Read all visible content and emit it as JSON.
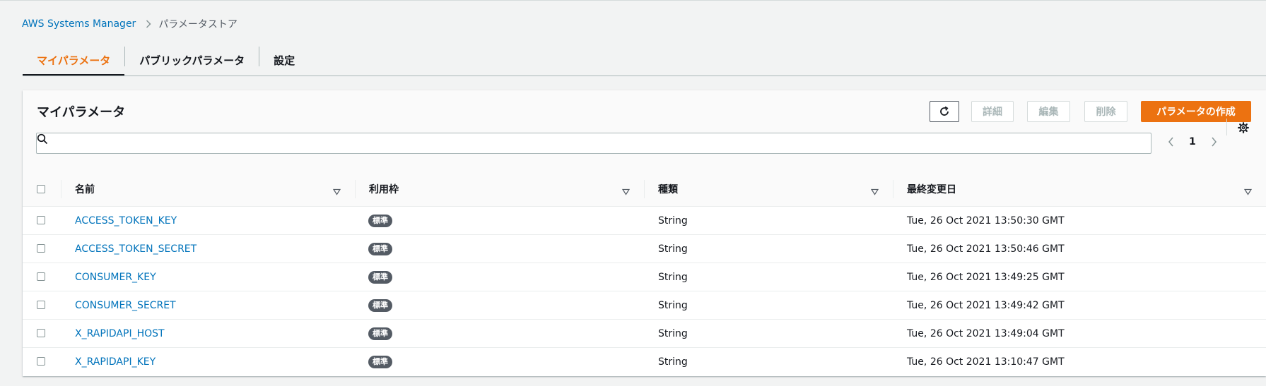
{
  "breadcrumb": {
    "root": "AWS Systems Manager",
    "current": "パラメータストア"
  },
  "tabs": [
    {
      "label": "マイパラメータ",
      "active": true
    },
    {
      "label": "パブリックパラメータ",
      "active": false
    },
    {
      "label": "設定",
      "active": false
    }
  ],
  "panel": {
    "title": "マイパラメータ",
    "buttons": {
      "details": "詳細",
      "edit": "編集",
      "delete": "削除",
      "create": "パラメータの作成"
    },
    "search": {
      "value": "",
      "placeholder": ""
    },
    "pagination": {
      "current_page": "1"
    },
    "table": {
      "columns": [
        "名前",
        "利用枠",
        "種類",
        "最終変更日"
      ],
      "rows": [
        {
          "name": "ACCESS_TOKEN_KEY",
          "tier": "標準",
          "type": "String",
          "last_modified": "Tue, 26 Oct 2021 13:50:30 GMT"
        },
        {
          "name": "ACCESS_TOKEN_SECRET",
          "tier": "標準",
          "type": "String",
          "last_modified": "Tue, 26 Oct 2021 13:50:46 GMT"
        },
        {
          "name": "CONSUMER_KEY",
          "tier": "標準",
          "type": "String",
          "last_modified": "Tue, 26 Oct 2021 13:49:25 GMT"
        },
        {
          "name": "CONSUMER_SECRET",
          "tier": "標準",
          "type": "String",
          "last_modified": "Tue, 26 Oct 2021 13:49:42 GMT"
        },
        {
          "name": "X_RAPIDAPI_HOST",
          "tier": "標準",
          "type": "String",
          "last_modified": "Tue, 26 Oct 2021 13:49:04 GMT"
        },
        {
          "name": "X_RAPIDAPI_KEY",
          "tier": "標準",
          "type": "String",
          "last_modified": "Tue, 26 Oct 2021 13:10:47 GMT"
        }
      ]
    }
  },
  "icons": {
    "breadcrumb_separator": "chevron-right-icon",
    "refresh": "refresh-icon",
    "search": "search-icon",
    "prev_page": "chevron-left-icon",
    "next_page": "chevron-right-icon",
    "settings": "gear-icon",
    "sort": "sort-caret-down-icon"
  },
  "colors": {
    "accent": "#ec7211",
    "link": "#0073bb",
    "badge": "#545b64",
    "background": "#f2f3f3"
  }
}
